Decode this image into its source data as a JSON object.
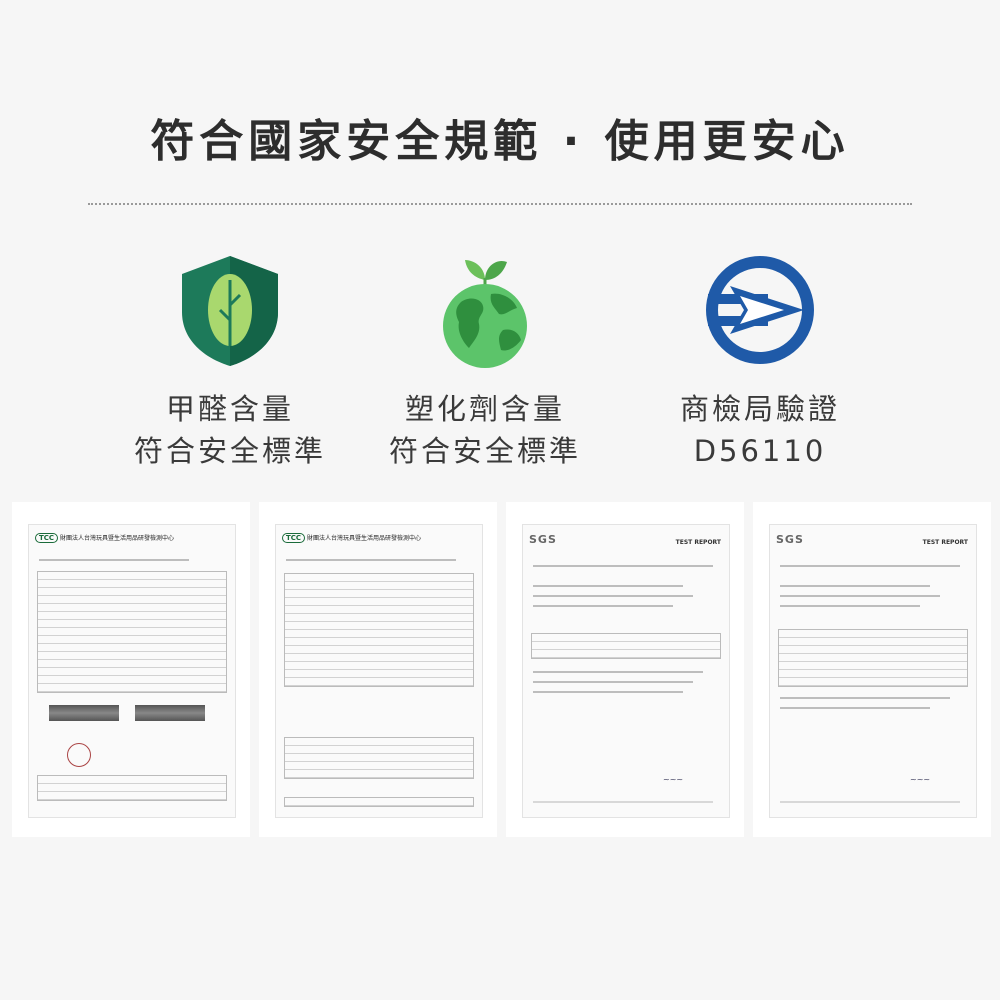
{
  "heading": "符合國家安全規範 · 使用更安心",
  "features": [
    {
      "icon": "shield-leaf-icon",
      "line1": "甲醛含量",
      "line2": "符合安全標準"
    },
    {
      "icon": "earth-sprout-icon",
      "line1": "塑化劑含量",
      "line2": "符合安全標準"
    },
    {
      "icon": "bsmi-mark-icon",
      "line1": "商檢局驗證",
      "line2": "D56110"
    }
  ],
  "reports": [
    {
      "lab_short": "TCC",
      "lab_name": "財團法人台灣玩具暨生活用品研發檢測中心"
    },
    {
      "lab_short": "TCC",
      "lab_name": "財團法人台灣玩具暨生活用品研發檢測中心"
    },
    {
      "lab_short": "SGS",
      "title": "TEST REPORT"
    },
    {
      "lab_short": "SGS",
      "title": "TEST REPORT"
    }
  ],
  "colors": {
    "shield_dark": "#1d7a5a",
    "shield_leaf": "#a9d86e",
    "earth_ocean": "#5cc46a",
    "earth_land": "#2f8f3e",
    "bsmi_blue": "#1f5aa8"
  }
}
